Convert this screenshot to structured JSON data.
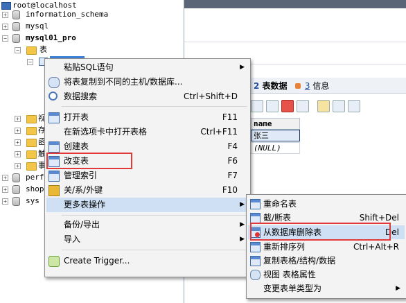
{
  "tree": {
    "items": [
      {
        "label": "root@localhost",
        "kind": "host"
      },
      {
        "label": "information_schema",
        "kind": "db"
      },
      {
        "label": "mysql",
        "kind": "db"
      },
      {
        "label": "mysql01_pro",
        "kind": "db"
      },
      {
        "label": "表",
        "kind": "folder"
      },
      {
        "label": "perf",
        "kind": "db"
      },
      {
        "label": "shop",
        "kind": "db"
      },
      {
        "label": "sys",
        "kind": "db"
      }
    ],
    "folder_fragments": [
      "视",
      "存",
      "函",
      "触",
      "事"
    ]
  },
  "right_panel": {
    "tabs": [
      {
        "num": "2",
        "label": "表数据"
      },
      {
        "num": "3",
        "label": "信息"
      }
    ],
    "result": {
      "column": "name",
      "rows": [
        "张三",
        "(NULL)"
      ]
    }
  },
  "context_menu": {
    "items": [
      {
        "label": "粘贴SQL语句",
        "shortcut": "",
        "submenu": true
      },
      {
        "label": "将表复制到不同的主机/数据库...",
        "shortcut": "",
        "submenu": false
      },
      {
        "label": "数据搜索",
        "shortcut": "Ctrl+Shift+D",
        "submenu": false
      },
      {
        "label": "打开表",
        "shortcut": "F11",
        "submenu": false
      },
      {
        "label": "在新选项卡中打开表格",
        "shortcut": "Ctrl+F11",
        "submenu": false
      },
      {
        "label": "创建表",
        "shortcut": "F4",
        "submenu": false
      },
      {
        "label": "改变表",
        "shortcut": "F6",
        "submenu": false
      },
      {
        "label": "管理索引",
        "shortcut": "F7",
        "submenu": false
      },
      {
        "label": "关/系/外键",
        "shortcut": "F10",
        "submenu": false
      },
      {
        "label": "更多表操作",
        "shortcut": "",
        "submenu": true
      },
      {
        "label": "备份/导出",
        "shortcut": "",
        "submenu": true
      },
      {
        "label": "导入",
        "shortcut": "",
        "submenu": true
      },
      {
        "label": "Create Trigger...",
        "shortcut": "",
        "submenu": false
      }
    ]
  },
  "submenu": {
    "items": [
      {
        "label": "重命名表",
        "shortcut": ""
      },
      {
        "label": "截/断表",
        "shortcut": "Shift+Del"
      },
      {
        "label": "从数据库删除表",
        "shortcut": "Del"
      },
      {
        "label": "重新排序列",
        "shortcut": "Ctrl+Alt+R"
      },
      {
        "label": "复制表格/结构/数据",
        "shortcut": ""
      },
      {
        "label": "视图 表格属性",
        "shortcut": ""
      },
      {
        "label": "变更表单类型为",
        "shortcut": ""
      }
    ]
  },
  "colors": {
    "highlight_box": "#e23a3a",
    "selection": "#3d82d8",
    "menu_hover": "#cfe0f5"
  }
}
